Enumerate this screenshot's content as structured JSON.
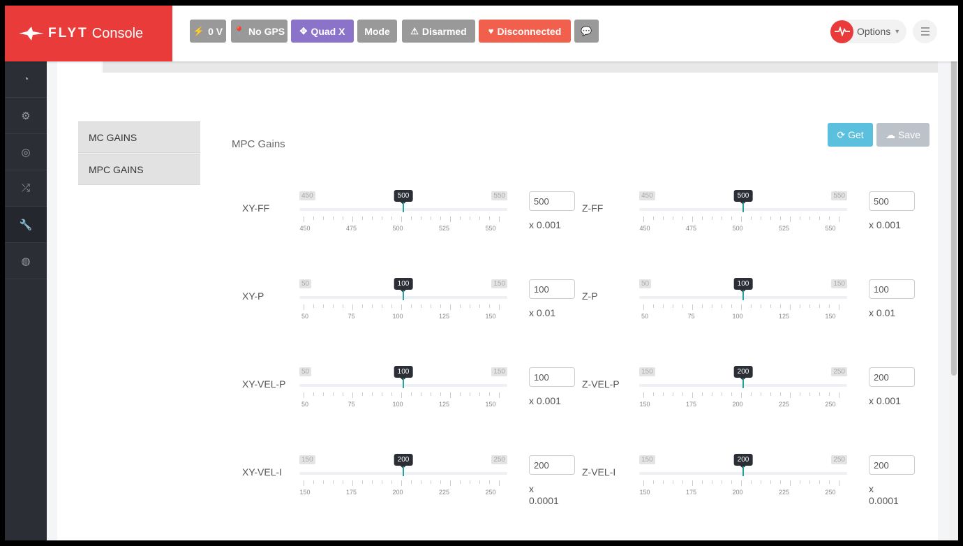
{
  "brand": {
    "flyt": "FLYT",
    "console": "Console",
    "color": "#e93b3a"
  },
  "status": [
    {
      "id": "voltage",
      "icon": "bolt-icon",
      "glyph": "⚡",
      "label": "0 V",
      "color": "#999999"
    },
    {
      "id": "gps",
      "icon": "map-marker-icon",
      "glyph": "📍",
      "label": "No GPS",
      "color": "#999999"
    },
    {
      "id": "frame",
      "icon": "arrows-move-icon",
      "glyph": "✥",
      "label": "Quad X",
      "color": "#8a73c9"
    },
    {
      "id": "mode",
      "icon": "",
      "glyph": "",
      "label": "Mode",
      "color": "#999999"
    },
    {
      "id": "arm",
      "icon": "warning-icon",
      "glyph": "⚠",
      "label": "Disarmed",
      "color": "#999999"
    },
    {
      "id": "conn",
      "icon": "heart-icon",
      "glyph": "♥",
      "label": "Disconnected",
      "color": "#f0604d"
    },
    {
      "id": "chat",
      "icon": "chat-icon",
      "glyph": "💬",
      "label": "",
      "color": "#999999"
    }
  ],
  "options": {
    "label": "Options"
  },
  "sidebar": [
    {
      "icon": "dashboard-icon",
      "glyph": "◔"
    },
    {
      "icon": "gear-icon",
      "glyph": "⚙"
    },
    {
      "icon": "target-icon",
      "glyph": "◎"
    },
    {
      "icon": "shuffle-icon",
      "glyph": "⤮"
    },
    {
      "icon": "wrench-icon",
      "glyph": "🔧",
      "active": true
    },
    {
      "icon": "globe-icon",
      "glyph": "◍"
    }
  ],
  "tabs": [
    "MC GAINS",
    "MPC GAINS"
  ],
  "section": {
    "title": "MPC Gains",
    "get_label": "Get",
    "save_label": "Save"
  },
  "gains": [
    {
      "name": "XY-FF",
      "min": 450,
      "max": 550,
      "value": 500,
      "ticks": [
        450,
        475,
        500,
        525,
        550
      ],
      "unit": "x 0.001"
    },
    {
      "name": "Z-FF",
      "min": 450,
      "max": 550,
      "value": 500,
      "ticks": [
        450,
        475,
        500,
        525,
        550
      ],
      "unit": "x 0.001"
    },
    {
      "name": "XY-P",
      "min": 50,
      "max": 150,
      "value": 100,
      "ticks": [
        50,
        75,
        100,
        125,
        150
      ],
      "unit": "x 0.01"
    },
    {
      "name": "Z-P",
      "min": 50,
      "max": 150,
      "value": 100,
      "ticks": [
        50,
        75,
        100,
        125,
        150
      ],
      "unit": "x 0.01"
    },
    {
      "name": "XY-VEL-P",
      "min": 50,
      "max": 150,
      "value": 100,
      "ticks": [
        50,
        75,
        100,
        125,
        150
      ],
      "unit": "x 0.001"
    },
    {
      "name": "Z-VEL-P",
      "min": 150,
      "max": 250,
      "value": 200,
      "ticks": [
        150,
        175,
        200,
        225,
        250
      ],
      "unit": "x 0.001"
    },
    {
      "name": "XY-VEL-I",
      "min": 150,
      "max": 250,
      "value": 200,
      "ticks": [
        150,
        175,
        200,
        225,
        250
      ],
      "unit": "x 0.0001"
    },
    {
      "name": "Z-VEL-I",
      "min": 150,
      "max": 250,
      "value": 200,
      "ticks": [
        150,
        175,
        200,
        225,
        250
      ],
      "unit": "x 0.0001"
    }
  ]
}
